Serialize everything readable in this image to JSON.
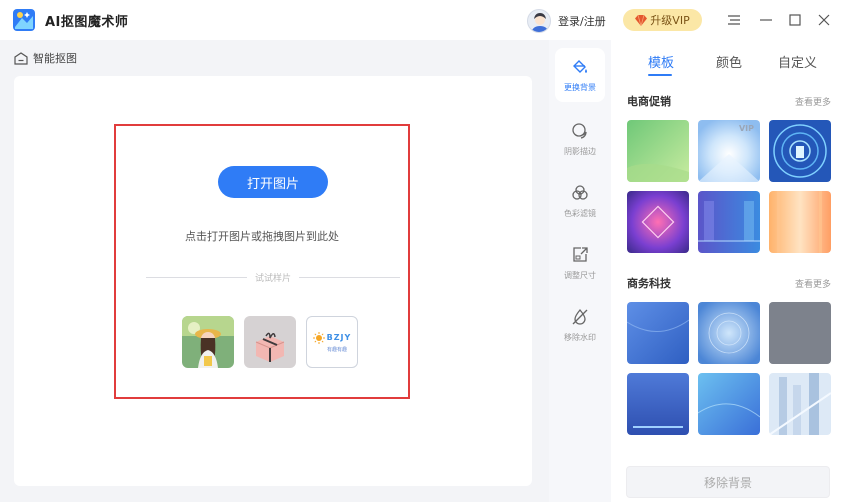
{
  "app": {
    "title": "AI抠图魔术师"
  },
  "header": {
    "login_label": "登录/注册",
    "vip_label": "升级VIP"
  },
  "breadcrumb": {
    "label": "智能抠图"
  },
  "canvas": {
    "open_button": "打开图片",
    "drop_hint": "点击打开图片或拖拽图片到此处",
    "sample_label": "试试样片",
    "sample3_text": "BZJY",
    "sample3_sub": "有趣有趣"
  },
  "tools": [
    {
      "label": "更换背景",
      "icon": "paint-bucket-icon"
    },
    {
      "label": "阴影描边",
      "icon": "shadow-icon"
    },
    {
      "label": "色彩滤镜",
      "icon": "color-filter-icon"
    },
    {
      "label": "调整尺寸",
      "icon": "resize-icon"
    },
    {
      "label": "移除水印",
      "icon": "remove-watermark-icon"
    }
  ],
  "panel": {
    "tabs": [
      "模板",
      "颜色",
      "自定义"
    ],
    "active_tab": "模板",
    "sections": [
      {
        "title": "电商促销",
        "more": "查看更多"
      },
      {
        "title": "商务科技",
        "more": "查看更多"
      }
    ],
    "vip_tag": "VIP",
    "remove_button": "移除背景"
  },
  "colors": {
    "accent": "#2f7cf6",
    "vip_bg": "#fbe7a6",
    "dropzone_border": "#e13c3c"
  }
}
